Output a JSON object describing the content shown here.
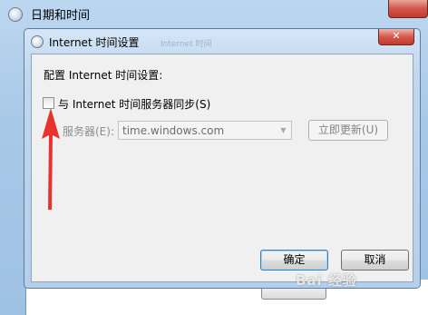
{
  "outer_window": {
    "title": "日期和时间"
  },
  "dialog": {
    "title": "Internet 时间设置",
    "ghost_title_text": "Internet 时间",
    "close_symbol": "✕",
    "config_label": "配置 Internet 时间设置:",
    "sync_checkbox": {
      "label": "与 Internet 时间服务器同步(S)",
      "checked": false
    },
    "server": {
      "label": "服务器(E):",
      "value": "time.windows.com",
      "enabled": false
    },
    "update_button": "立即更新(U)",
    "ok_button": "确定",
    "cancel_button": "取消"
  },
  "annotation": {
    "type": "red-arrow",
    "color": "#e8322e",
    "points_to": "sync-checkbox"
  },
  "watermark": {
    "text": "Bai 经验"
  },
  "icons": {
    "outer": "clock-icon",
    "dialog": "clock-icon",
    "close": "close-icon",
    "combo": "chevron-down-icon"
  }
}
